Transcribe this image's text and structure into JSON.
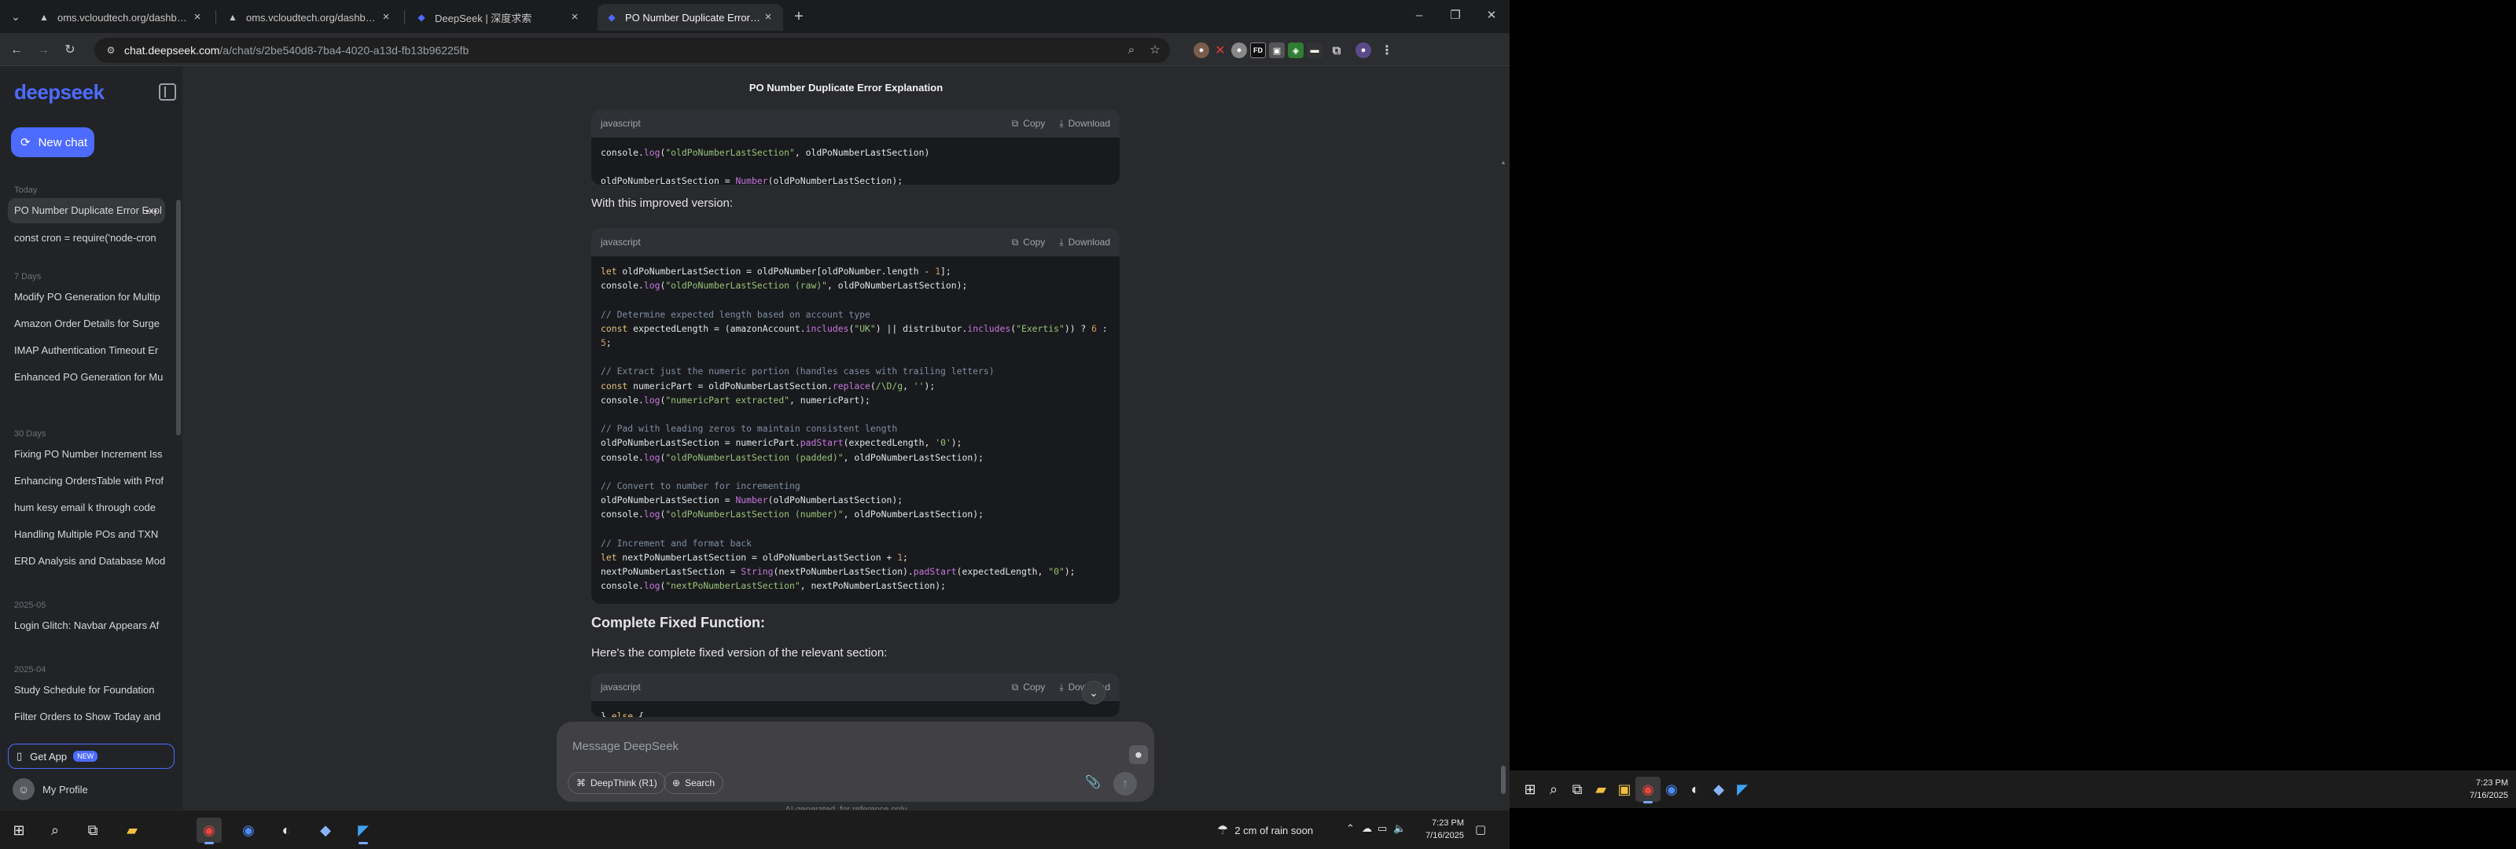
{
  "browser": {
    "tabs": [
      {
        "label": "oms.vcloudtech.org/dashboard",
        "favicon": "globe-icon",
        "active": false
      },
      {
        "label": "oms.vcloudtech.org/dashboard",
        "favicon": "globe-icon",
        "active": false
      },
      {
        "label": "DeepSeek | 深度求索",
        "favicon": "deepseek-icon",
        "active": false
      },
      {
        "label": "PO Number Duplicate Error Exp",
        "favicon": "deepseek-icon",
        "active": true
      }
    ],
    "url_host": "chat.deepseek.com",
    "url_path": "/a/chat/s/2be540d8-7ba4-4020-a13d-fb13b96225fb"
  },
  "sidebar": {
    "logo": "deepseek",
    "new_chat_label": "New chat",
    "groups": [
      {
        "label": "Today",
        "items": [
          {
            "label": "PO Number Duplicate Error Expl",
            "active": true
          },
          {
            "label": "const cron = require('node-cron",
            "active": false
          }
        ]
      },
      {
        "label": "7 Days",
        "items": [
          {
            "label": "Modify PO Generation for Multip",
            "active": false
          },
          {
            "label": "Amazon Order Details for Surge",
            "active": false
          },
          {
            "label": "IMAP Authentication Timeout Er",
            "active": false
          },
          {
            "label": "Enhanced PO Generation for Mu",
            "active": false
          }
        ]
      },
      {
        "label": "30 Days",
        "items": [
          {
            "label": "Fixing PO Number Increment Iss",
            "active": false
          },
          {
            "label": "Enhancing OrdersTable with Prof",
            "active": false
          },
          {
            "label": "hum kesy email k through code",
            "active": false
          },
          {
            "label": "Handling Multiple POs and TXN",
            "active": false
          },
          {
            "label": "ERD Analysis and Database Mod",
            "active": false
          }
        ]
      },
      {
        "label": "2025-05",
        "items": [
          {
            "label": "Login Glitch: Navbar Appears Af",
            "active": false
          }
        ]
      },
      {
        "label": "2025-04",
        "items": [
          {
            "label": "Study Schedule for Foundation",
            "active": false
          },
          {
            "label": "Filter Orders to Show Today and",
            "active": false
          }
        ]
      }
    ],
    "get_app_label": "Get App",
    "get_app_badge": "NEW",
    "profile_label": "My Profile"
  },
  "chat": {
    "title": "PO Number Duplicate Error Explanation",
    "copy_label": "Copy",
    "download_label": "Download",
    "lang_label": "javascript",
    "prose1": "With this improved version:",
    "heading": "Complete Fixed Function:",
    "prose2": "Here's the complete fixed version of the relevant section:",
    "composer_placeholder": "Message DeepSeek",
    "deepthink_label": "DeepThink (R1)",
    "search_label": "Search",
    "footer_note": "AI-generated, for reference only"
  },
  "taskbar": {
    "weather_text": "2 cm of rain soon",
    "time": "7:23 PM",
    "date": "7/16/2025"
  },
  "colors": {
    "accent": "#4d6bfe",
    "bg_main": "#292a2d",
    "bg_sidebar": "#212327",
    "code_bg": "#181a1d"
  }
}
